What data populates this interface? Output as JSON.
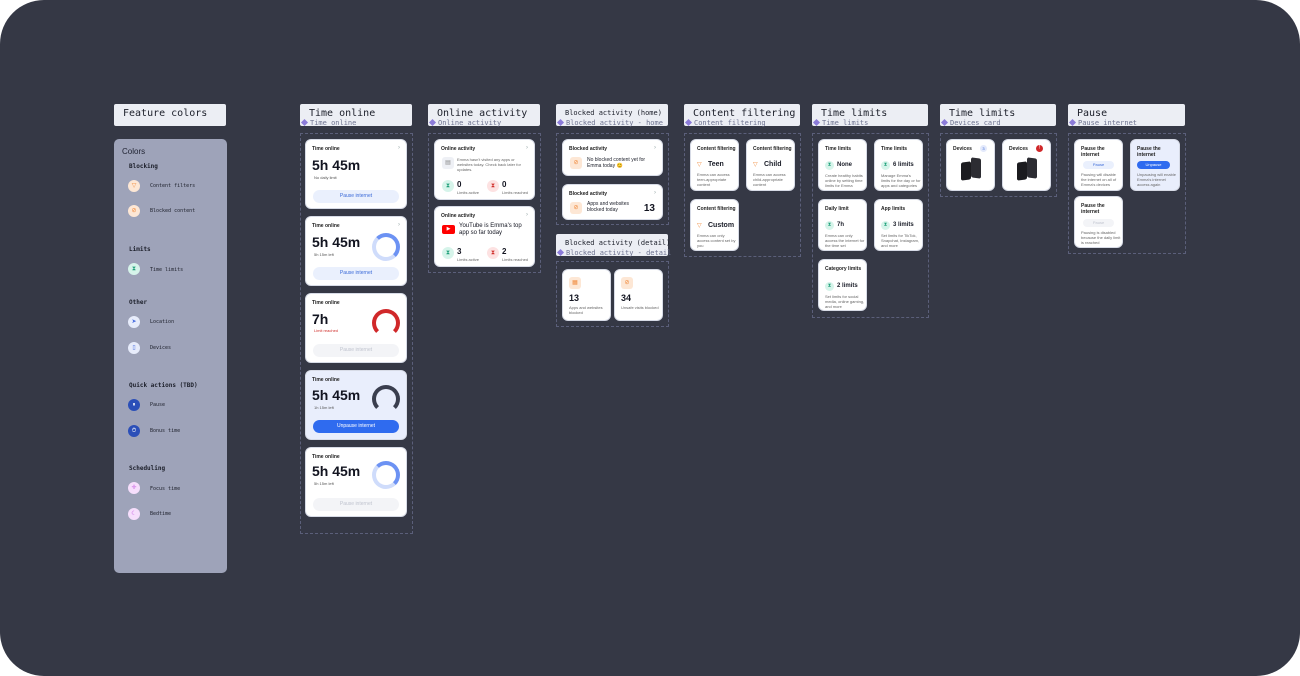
{
  "headers": {
    "feature_colors": "Feature colors",
    "time_online": "Time online",
    "online_activity": "Online activity",
    "blocked_home": "Blocked activity (home)",
    "content_filtering": "Content filtering",
    "time_limits_a": "Time limits",
    "time_limits_b": "Time limits",
    "pause": "Pause",
    "blocked_detail": "Blocked activity (detail)"
  },
  "subs": {
    "time_online": "Time online",
    "online_activity": "Online activity",
    "blocked_home": "Blocked activity - home",
    "content_filtering": "Content filtering",
    "time_limits_a": "Time limits",
    "time_limits_b": "Devices card",
    "pause": "Pause internet",
    "blocked_detail": "Blocked activity - detail"
  },
  "colors_panel": {
    "title": "Colors",
    "blocking": "Blocking",
    "content_filters": "Content filters",
    "blocked_content": "Blocked content",
    "limits": "Limits",
    "time_limits": "Time limits",
    "other": "Other",
    "location": "Location",
    "devices": "Devices",
    "quick_actions": "Quick actions (TBD)",
    "pause": "Pause",
    "bonus_time": "Bonus time",
    "scheduling": "Scheduling",
    "focus_time": "Focus time",
    "bedtime": "Bedtime"
  },
  "time_cards": [
    {
      "title": "Time online",
      "value": "5h 45m",
      "meta": "No daily limit",
      "button": "Pause internet"
    },
    {
      "title": "Time online",
      "value": "5h 45m",
      "meta": "5h 15m left",
      "button": "Pause internet"
    },
    {
      "title": "Time online",
      "value": "7h",
      "meta": "Limit reached",
      "button": "Pause internet"
    },
    {
      "title": "Time online",
      "value": "5h 45m",
      "meta": "1h 15m left",
      "button": "Unpause internet"
    },
    {
      "title": "Time online",
      "value": "5h 45m",
      "meta": "5h 15m left",
      "button": "Pause internet"
    }
  ],
  "online_activity": {
    "card1": {
      "title": "Online activity",
      "text": "Emma hasn't visited any apps or websites today. Check back later for updates.",
      "n1": "0",
      "l1": "Limits active",
      "n2": "0",
      "l2": "Limits reached"
    },
    "card2": {
      "title": "Online activity",
      "text": "YouTube is Emma's top app so far today",
      "n1": "3",
      "l1": "Limits active",
      "n2": "2",
      "l2": "Limits reached"
    }
  },
  "blocked_home": {
    "card1": {
      "title": "Blocked activity",
      "text": "No blocked content yet for Emma today 😊"
    },
    "card2": {
      "title": "Blocked activity",
      "text": "Apps and websites blocked today",
      "num": "13"
    }
  },
  "blocked_detail": [
    {
      "num": "13",
      "text": "Apps and websites blocked"
    },
    {
      "num": "34",
      "text": "Unsafe visits blocked"
    }
  ],
  "content_filtering": [
    {
      "title": "Content filtering",
      "value": "Teen",
      "text": "Emma can access teen-appropriate content"
    },
    {
      "title": "Content filtering",
      "value": "Child",
      "text": "Emma can access child-appropriate content"
    },
    {
      "title": "Content filtering",
      "value": "Custom",
      "text": "Emma can only access content set by you"
    }
  ],
  "time_limits": [
    {
      "title": "Time limits",
      "value": "None",
      "text": "Create healthy habits online by setting time limits for Emma"
    },
    {
      "title": "Time limits",
      "value": "6 limits",
      "text": "Manage Emma's limits for the day or for apps and categories"
    },
    {
      "title": "Daily limit",
      "value": "7h",
      "text": "Emma can only access the internet for the time set"
    },
    {
      "title": "App limits",
      "value": "3 limits",
      "text": "Set limits for TikTok, Snapchat, Instagram, and more"
    },
    {
      "title": "Category limits",
      "value": "2 limits",
      "text": "Set limits for social media, online gaming, and more"
    }
  ],
  "devices": [
    {
      "title": "Devices",
      "badge": "3"
    },
    {
      "title": "Devices",
      "badge": "!"
    }
  ],
  "pause_cards": [
    {
      "title": "Pause the internet",
      "button": "Pause",
      "text": "Pausing will disable the internet on all of Emma's devices"
    },
    {
      "title": "Pause the internet",
      "button": "Unpause",
      "text": "Unpausing will enable Emma's internet access again"
    },
    {
      "title": "Pause the internet",
      "button": "Pause",
      "text": "Pausing is disabled because the daily limit is reached"
    }
  ]
}
